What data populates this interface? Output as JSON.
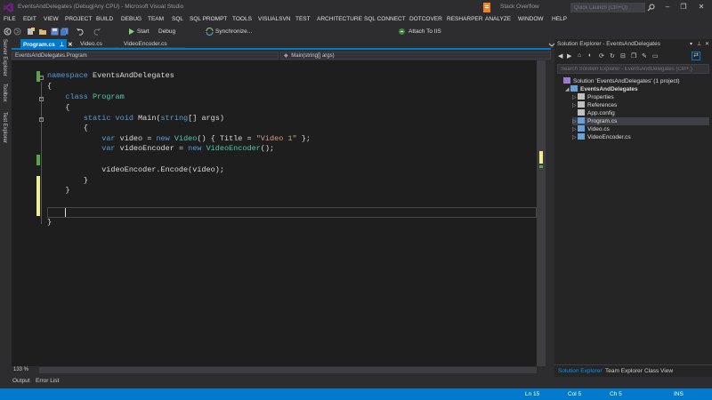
{
  "window": {
    "title": "EventsAndDelegates (Debug|Any CPU) - Microsoft Visual Studio",
    "extension_text": "Stack Overflow",
    "quick_launch_placeholder": "Quick Launch (Ctrl+Q)",
    "controls": [
      "–",
      "❐",
      "✕"
    ]
  },
  "menu": [
    "FILE",
    "EDIT",
    "VIEW",
    "PROJECT",
    "BUILD",
    "DEBUG",
    "TEAM",
    "SQL",
    "SQL PROMPT",
    "TOOLS",
    "VISUALSVN",
    "TEST",
    "ARCHITECTURE",
    "SQL CONNECT",
    "DOTCOVER",
    "RESHARPER",
    "ANALYZE",
    "WINDOW",
    "HELP"
  ],
  "toolbar": {
    "start_label": "Start",
    "config_label": "Debug",
    "sync_label": "Synchronize...",
    "attach_label": "Attach To IIS"
  },
  "left_rail": [
    "Server Explorer",
    "Toolbox",
    "Test Explorer"
  ],
  "tabs": [
    {
      "label": "Program.cs",
      "active": true
    },
    {
      "label": "Video.cs",
      "active": false
    },
    {
      "label": "VideoEncoder.cs",
      "active": false
    }
  ],
  "navbar": {
    "type_combo": "EventsAndDelegates.Program",
    "member_combo": "Main(string[] args)"
  },
  "code": [
    {
      "tokens": [
        [
          "kw",
          "namespace"
        ],
        [
          "pl",
          " EventsAndDelegates"
        ]
      ]
    },
    {
      "tokens": [
        [
          "pl",
          "{"
        ]
      ]
    },
    {
      "tokens": [
        [
          "pl",
          "    "
        ],
        [
          "kw",
          "class"
        ],
        [
          "pl",
          " "
        ],
        [
          "ty",
          "Program"
        ]
      ]
    },
    {
      "tokens": [
        [
          "pl",
          "    {"
        ]
      ]
    },
    {
      "tokens": [
        [
          "pl",
          "        "
        ],
        [
          "kw",
          "static"
        ],
        [
          "pl",
          " "
        ],
        [
          "kw",
          "void"
        ],
        [
          "pl",
          " Main("
        ],
        [
          "kw",
          "string"
        ],
        [
          "pl",
          "[] args)"
        ]
      ]
    },
    {
      "tokens": [
        [
          "pl",
          "        {"
        ]
      ]
    },
    {
      "tokens": [
        [
          "pl",
          "            "
        ],
        [
          "kw",
          "var"
        ],
        [
          "pl",
          " video = "
        ],
        [
          "kw",
          "new"
        ],
        [
          "pl",
          " "
        ],
        [
          "ty",
          "Video"
        ],
        [
          "pl",
          "() { Title = "
        ],
        [
          "st",
          "\"Video 1\""
        ],
        [
          "pl",
          " };"
        ]
      ]
    },
    {
      "tokens": [
        [
          "pl",
          "            "
        ],
        [
          "kw",
          "var"
        ],
        [
          "pl",
          " videoEncoder = "
        ],
        [
          "kw",
          "new"
        ],
        [
          "pl",
          " "
        ],
        [
          "ty",
          "VideoEncoder"
        ],
        [
          "pl",
          "();"
        ]
      ]
    },
    {
      "tokens": [
        [
          "pl",
          ""
        ]
      ]
    },
    {
      "tokens": [
        [
          "pl",
          "            videoEncoder.Encode(video);"
        ]
      ]
    },
    {
      "tokens": [
        [
          "pl",
          "        }"
        ]
      ]
    },
    {
      "tokens": [
        [
          "pl",
          "    }"
        ]
      ]
    },
    {
      "tokens": [
        [
          "pl",
          ""
        ]
      ]
    },
    {
      "tokens": [
        [
          "pl",
          ""
        ]
      ]
    },
    {
      "tokens": [
        [
          "pl",
          ""
        ]
      ]
    },
    {
      "tokens": [
        [
          "pl",
          "}"
        ]
      ]
    }
  ],
  "zoom": "133 %",
  "bottom_tabs": [
    "Output",
    "Error List"
  ],
  "solution_explorer": {
    "title": "Solution Explorer - EventsAndDelegates",
    "search_placeholder": "Search Solution Explorer - EventsAndDelegates (Ctrl+;)",
    "nodes": [
      {
        "label": "Solution 'EventsAndDelegates' (1 project)",
        "level": 0,
        "arrow": "",
        "icon": "solution-icon",
        "color": "#9b7bd1",
        "bold": false
      },
      {
        "label": "EventsAndDelegates",
        "level": 1,
        "arrow": "◢",
        "icon": "csharp-project-icon",
        "color": "#68a0d8",
        "bold": true
      },
      {
        "label": "Properties",
        "level": 2,
        "arrow": "▷",
        "icon": "wrench-icon",
        "color": "#c0c0c0",
        "bold": false
      },
      {
        "label": "References",
        "level": 2,
        "arrow": "▷",
        "icon": "references-icon",
        "color": "#c0c0c0",
        "bold": false
      },
      {
        "label": "App.config",
        "level": 2,
        "arrow": "",
        "icon": "config-file-icon",
        "color": "#c0c0c0",
        "bold": false
      },
      {
        "label": "Program.cs",
        "level": 2,
        "arrow": "▷",
        "icon": "csharp-file-icon",
        "color": "#68a0d8",
        "bold": false,
        "selected": true
      },
      {
        "label": "Video.cs",
        "level": 2,
        "arrow": "▷",
        "icon": "csharp-file-icon",
        "color": "#68a0d8",
        "bold": false
      },
      {
        "label": "VideoEncoder.cs",
        "level": 2,
        "arrow": "▷",
        "icon": "csharp-file-icon",
        "color": "#68a0d8",
        "bold": false
      }
    ],
    "bottom_tabs": [
      "Solution Explorer",
      "Team Explorer",
      "Class View"
    ]
  },
  "status": {
    "line": "Ln 15",
    "col": "Col 5",
    "ch": "Ch 5",
    "mode": "INS"
  },
  "colors": {
    "accent": "#007acc",
    "keyword": "#569cd6",
    "type": "#4ec9b0",
    "string": "#d69d85",
    "change_saved": "#57a64a",
    "change_unsaved": "#efef91"
  }
}
